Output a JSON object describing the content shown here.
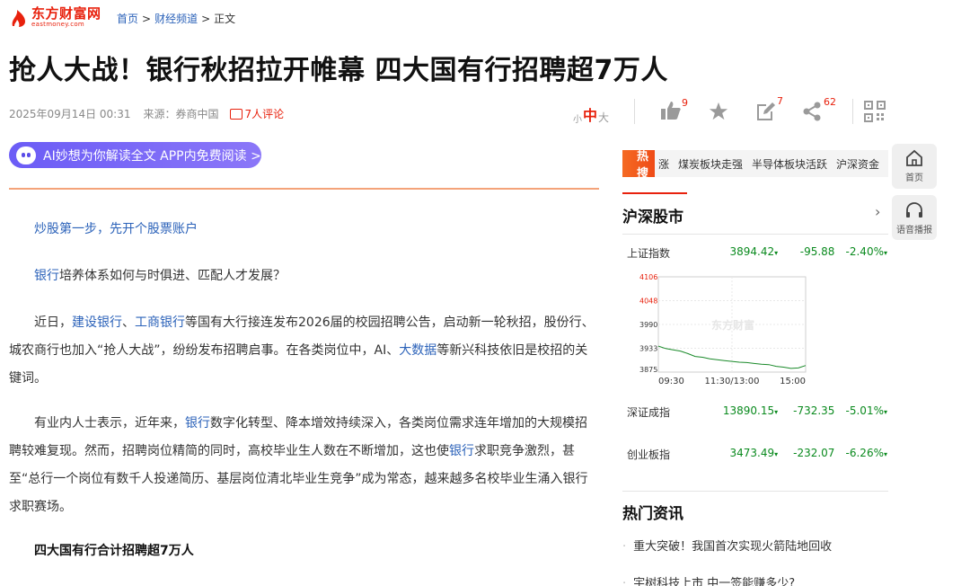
{
  "site": {
    "logo_cn": "东方财富网",
    "logo_en": "eastmoney.com",
    "brand_color": "#e8210d"
  },
  "breadcrumb": {
    "home": "首页",
    "channel": "财经频道",
    "sep": ">",
    "current": "正文"
  },
  "article": {
    "title": "抢人大战！银行秋招拉开帷幕 四大国有行招聘超7万人",
    "date": "2025年09月14日 00:31",
    "source": "来源：券商中国",
    "comments": "7人评论",
    "ai_button": "AI妙想为你解读全文 APP内免费阅读 >",
    "promo": "炒股第一步，先开个股票账户",
    "p1_link": "银行",
    "p1_rest": "培养体系如何与时俱进、匹配人才发展？",
    "p2": {
      "a": "近日，",
      "l1": "建设银行",
      "b": "、",
      "l2": "工商银行",
      "c": "等国有大行接连发布2026届的校园招聘公告，启动新一轮秋招，股份行、城农商行也加入“抢人大战”，纷纷发布招聘启事。在各类岗位中，AI、",
      "l3": "大数据",
      "d": "等新兴科技依旧是校招的关键词。"
    },
    "p3": {
      "a": "有业内人士表示，近年来，",
      "l1": "银行",
      "b": "数字化转型、降本增效持续深入，各类岗位需求连年增加的大规模招聘较难复现。然而，招聘岗位精简的同时，高校毕业生人数在不断增加，这也使",
      "l2": "银行",
      "c": "求职竞争激烈，甚至“总行一个岗位有数千人投递简历、基层岗位清北毕业生竞争”成为常态，越来越多名校毕业生涌入银行求职赛场。"
    },
    "subhead": "四大国有行合计招聘超7万人"
  },
  "font_size": {
    "small": "小",
    "medium": "中",
    "large": "大"
  },
  "toolbar": {
    "like_count": "9",
    "edit_count": "7",
    "share_count": "62"
  },
  "hot": {
    "tag": "热搜",
    "items": [
      "涨",
      "煤炭板块走强",
      "半导体板块活跃",
      "沪深资金"
    ]
  },
  "market": {
    "title": "沪深股市",
    "rows": [
      {
        "name": "上证指数",
        "value": "3894.42",
        "change": "-95.88",
        "pct": "-2.40%",
        "arrow": "▾"
      },
      {
        "name": "深证成指",
        "value": "13890.15",
        "change": "-732.35",
        "pct": "-5.01%",
        "arrow": "▾"
      },
      {
        "name": "创业板指",
        "value": "3473.49",
        "change": "-232.07",
        "pct": "-6.26%",
        "arrow": "▾"
      }
    ],
    "down_color": "#0a8a1e"
  },
  "chart_data": {
    "type": "line",
    "title": "",
    "watermark": "东方财富",
    "y_ticks": [
      "4106",
      "4048",
      "3990",
      "3933",
      "3875"
    ],
    "x_ticks": [
      "09:30",
      "11:30/13:00",
      "15:00"
    ],
    "ylim": [
      3875,
      4106
    ],
    "x": [
      0,
      0.05,
      0.1,
      0.15,
      0.2,
      0.25,
      0.3,
      0.35,
      0.4,
      0.45,
      0.5,
      0.55,
      0.6,
      0.65,
      0.7,
      0.75,
      0.8,
      0.85,
      0.9,
      0.95,
      1.0
    ],
    "values": [
      3938,
      3932,
      3929,
      3926,
      3920,
      3913,
      3911,
      3907,
      3905,
      3903,
      3901,
      3899,
      3898,
      3896,
      3894,
      3893,
      3889,
      3887,
      3884,
      3885,
      3891
    ],
    "series_color": "#1a8a2a",
    "grid": true
  },
  "hot_news": {
    "title": "热门资讯",
    "items": [
      "重大突破！我国首次实现火箭陆地回收",
      "宇树科技上市 中一签能赚多少?"
    ]
  },
  "side": {
    "home": "首页",
    "voice": "语音播报"
  }
}
